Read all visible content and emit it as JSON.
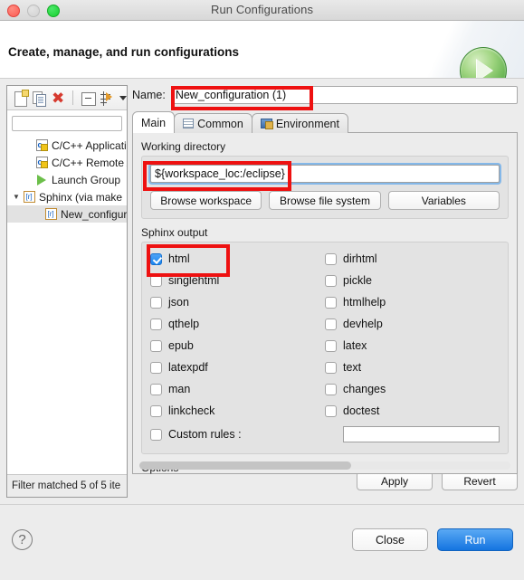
{
  "window": {
    "title": "Run Configurations",
    "traffic_lights": [
      "close-red",
      "minimize-gray",
      "maximize-green"
    ]
  },
  "header": {
    "title": "Create, manage, and run configurations",
    "icon": "run-play-icon"
  },
  "left_panel": {
    "toolbar": [
      {
        "name": "new-configuration-icon",
        "label": "New"
      },
      {
        "name": "duplicate-configuration-icon",
        "label": "Duplicate"
      },
      {
        "name": "delete-configuration-icon",
        "label": "Delete"
      },
      {
        "name": "collapse-all-icon",
        "label": "Collapse All"
      },
      {
        "name": "filter-icon",
        "label": "Filter"
      }
    ],
    "filter_input": {
      "value": "",
      "placeholder": ""
    },
    "tree": [
      {
        "label": "C/C++ Applicatio",
        "icon": "c-cpp-icon",
        "depth": 1,
        "expandable": false,
        "selected": false
      },
      {
        "label": "C/C++ Remote A",
        "icon": "c-cpp-icon",
        "depth": 1,
        "expandable": false,
        "selected": false
      },
      {
        "label": "Launch Group",
        "icon": "launch-group-icon",
        "depth": 1,
        "expandable": false,
        "selected": false
      },
      {
        "label": "Sphinx (via make",
        "icon": "sphinx-icon",
        "depth": 0,
        "expandable": true,
        "expanded": true,
        "selected": false
      },
      {
        "label": "New_configura",
        "icon": "sphinx-icon",
        "depth": 2,
        "expandable": false,
        "selected": true
      }
    ],
    "status": "Filter matched 5 of 5 ite"
  },
  "right_panel": {
    "name_label": "Name:",
    "name_value": "New_configuration (1)",
    "tabs": [
      {
        "label": "Main",
        "icon": null,
        "active": true
      },
      {
        "label": "Common",
        "icon": "common-table-icon",
        "active": false
      },
      {
        "label": "Environment",
        "icon": "environment-icon",
        "active": false
      }
    ],
    "working_directory": {
      "group_title": "Working directory",
      "value": "${workspace_loc:/eclipse}",
      "buttons": [
        "Browse workspace",
        "Browse file system",
        "Variables"
      ]
    },
    "sphinx_output": {
      "group_title": "Sphinx output",
      "left_column": [
        {
          "label": "html",
          "checked": true
        },
        {
          "label": "singlehtml",
          "checked": false
        },
        {
          "label": "json",
          "checked": false
        },
        {
          "label": "qthelp",
          "checked": false
        },
        {
          "label": "epub",
          "checked": false
        },
        {
          "label": "latexpdf",
          "checked": false
        },
        {
          "label": "man",
          "checked": false
        },
        {
          "label": "linkcheck",
          "checked": false
        }
      ],
      "right_column": [
        {
          "label": "dirhtml",
          "checked": false
        },
        {
          "label": "pickle",
          "checked": false
        },
        {
          "label": "htmlhelp",
          "checked": false
        },
        {
          "label": "devhelp",
          "checked": false
        },
        {
          "label": "latex",
          "checked": false
        },
        {
          "label": "text",
          "checked": false
        },
        {
          "label": "changes",
          "checked": false
        },
        {
          "label": "doctest",
          "checked": false
        }
      ],
      "custom_rules": {
        "label": "Custom rules :",
        "checked": false,
        "value": ""
      }
    },
    "options_title": "Options",
    "apply_label": "Apply",
    "revert_label": "Revert"
  },
  "footer": {
    "help_icon": "question-mark-icon",
    "close_label": "Close",
    "run_label": "Run"
  },
  "annotations": {
    "accent_red": "#ee1111",
    "highlighted": [
      "name-field",
      "working-directory-field",
      "html-checkbox"
    ]
  }
}
